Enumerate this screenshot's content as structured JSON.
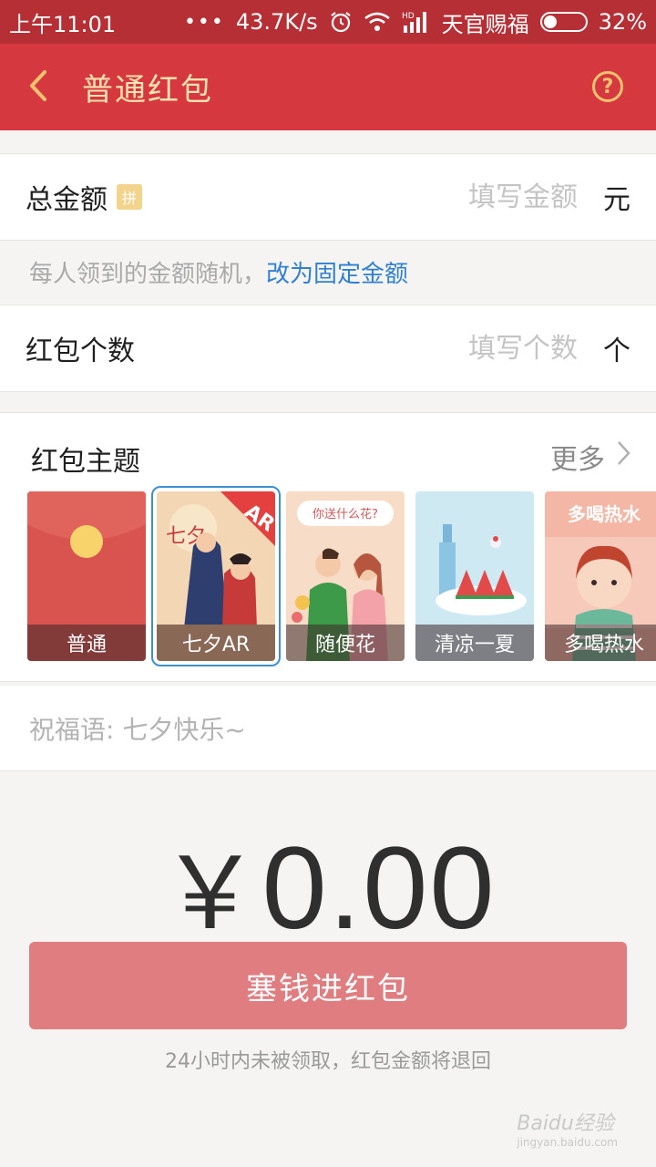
{
  "status_bar": {
    "time": "上午11:01",
    "dots": "•••",
    "speed": "43.7K/s",
    "signal_label": "HD",
    "carrier": "天官赐福",
    "battery": "32%",
    "battery_level": 0.32
  },
  "header": {
    "title": "普通红包",
    "help": "?"
  },
  "total": {
    "label": "总金额",
    "badge": "拼",
    "placeholder": "填写金额",
    "unit": "元"
  },
  "hint": {
    "text": "每人领到的金额随机，",
    "link": "改为固定金额"
  },
  "count": {
    "label": "红包个数",
    "placeholder": "填写个数",
    "unit": "个"
  },
  "theme": {
    "title": "红包主题",
    "more": "更多",
    "items": [
      {
        "label": "普通"
      },
      {
        "label": "七夕AR",
        "badge": "AR",
        "art_text": "七夕"
      },
      {
        "label": "随便花",
        "art_text": "你送什么花?"
      },
      {
        "label": "清凉一夏"
      },
      {
        "label": "多喝热水",
        "art_text": "多喝热水"
      }
    ]
  },
  "blessing": {
    "placeholder": "祝福语: 七夕快乐~"
  },
  "amount": {
    "currency": "￥",
    "value": "0.00"
  },
  "submit": {
    "label": "塞钱进红包"
  },
  "footnote": "24小时内未被领取，红包金额将退回",
  "watermark": {
    "text": "Baidu经验",
    "sub": "jingyan.baidu.com"
  },
  "colors": {
    "header_bg": "#d5393f",
    "status_bg": "#b52f34",
    "title_gold": "#fbe2b0",
    "link_blue": "#2f80d1",
    "button": "#df7d80"
  }
}
